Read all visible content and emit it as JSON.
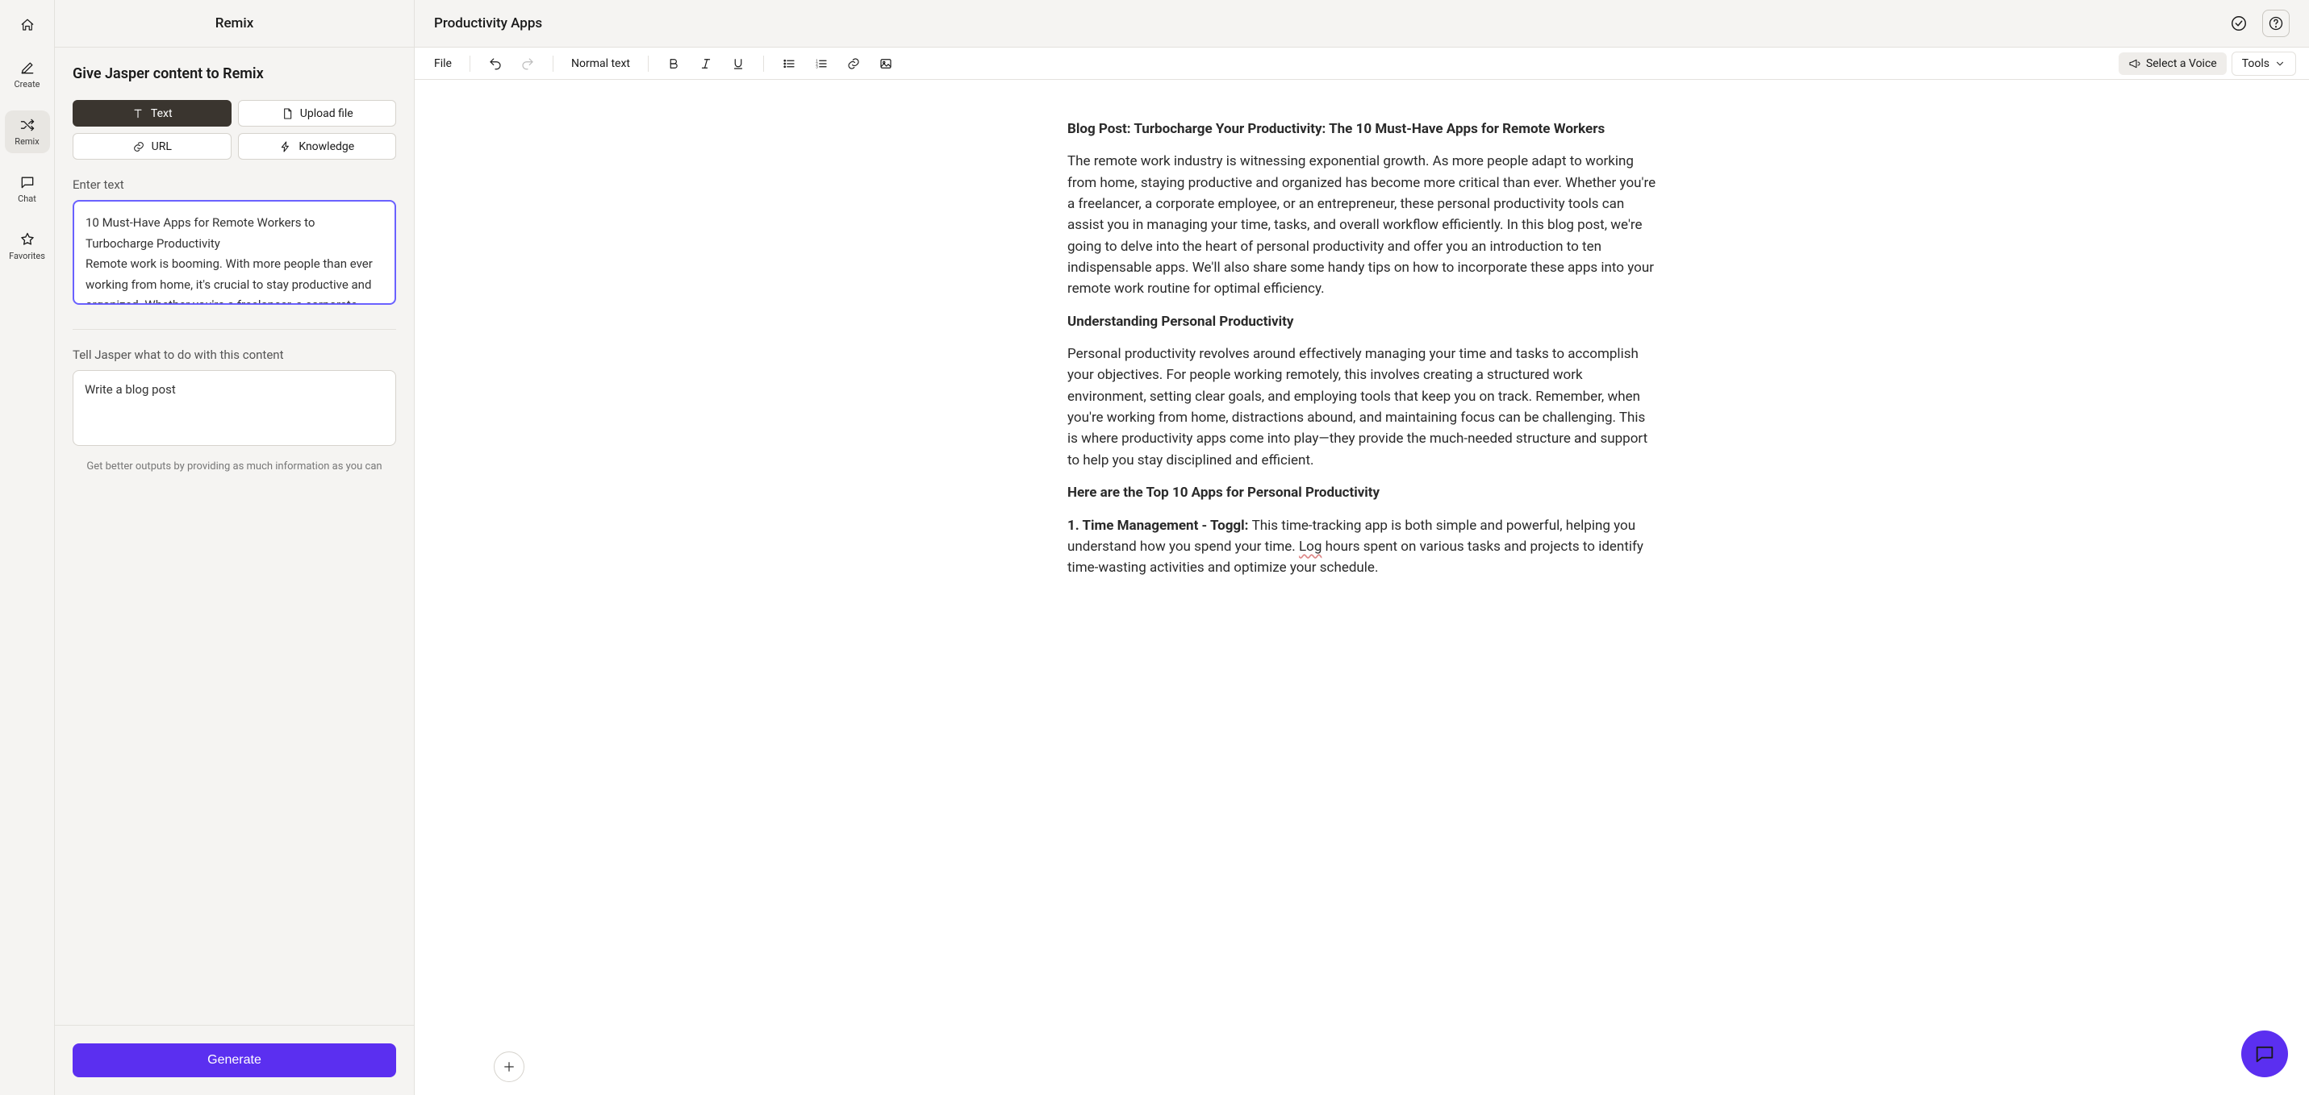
{
  "nav": {
    "create": "Create",
    "remix": "Remix",
    "chat": "Chat",
    "favorites": "Favorites"
  },
  "remix": {
    "title": "Remix",
    "instruction_heading": "Give Jasper content to Remix",
    "types": {
      "text": "Text",
      "upload": "Upload file",
      "url": "URL",
      "knowledge": "Knowledge"
    },
    "enter_text_label": "Enter text",
    "text_value": "10 Must-Have Apps for Remote Workers to Turbocharge Productivity\nRemote work is booming. With more people than ever working from home, it's crucial to stay productive and organized. Whether you're a freelancer, a corporate",
    "tell_jasper_label": "Tell Jasper what to do with this content",
    "instruction_value": "Write a blog post",
    "hint": "Get better outputs by providing as much information as you can",
    "generate": "Generate"
  },
  "editor": {
    "title": "Productivity Apps",
    "toolbar": {
      "file": "File",
      "style": "Normal text",
      "voice": "Select a Voice",
      "tools": "Tools"
    },
    "content": {
      "p1_lead": "Blog Post: Turbocharge Your Productivity: The 10 Must-Have Apps for Remote Workers",
      "p2": "The remote work industry is witnessing exponential growth. As more people adapt to working from home, staying productive and organized has become more critical than ever. Whether you're a freelancer, a corporate employee, or an entrepreneur, these personal productivity tools can assist you in managing your time, tasks, and overall workflow efficiently. In this blog post, we're going to delve into the heart of personal productivity and offer you an introduction to ten indispensable apps. We'll also share some handy tips on how to incorporate these apps into your remote work routine for optimal efficiency.",
      "h2_1": "Understanding Personal Productivity",
      "p3": "Personal productivity revolves around effectively managing your time and tasks to accomplish your objectives. For people working remotely, this involves creating a structured work environment, setting clear goals, and employing tools that keep you on track. Remember, when you're working from home, distractions abound, and maintaining focus can be challenging. This is where productivity apps come into play—they provide the much-needed structure and support to help you stay disciplined and efficient.",
      "h2_2": "Here are the Top 10 Apps for Personal Productivity",
      "li1_bold": "1. Time Management - Toggl: ",
      "li1_rest_a": "This time-tracking app is both simple and powerful, helping you understand how you spend your time. ",
      "li1_log": "Log",
      "li1_rest_b": " hours spent on various tasks and projects to identify time-wasting activities and optimize your schedule."
    }
  }
}
